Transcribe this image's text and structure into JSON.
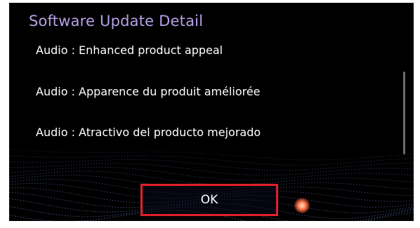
{
  "dialog": {
    "title": "Software Update Detail",
    "items": [
      "Audio : Enhanced product appeal",
      "Audio : Apparence du produit améliorée",
      "Audio : Atractivo del producto mejorado"
    ],
    "ok_label": "OK"
  },
  "colors": {
    "title": "#b4a2e6",
    "highlight_border": "#e0202a",
    "background": "#000000"
  }
}
